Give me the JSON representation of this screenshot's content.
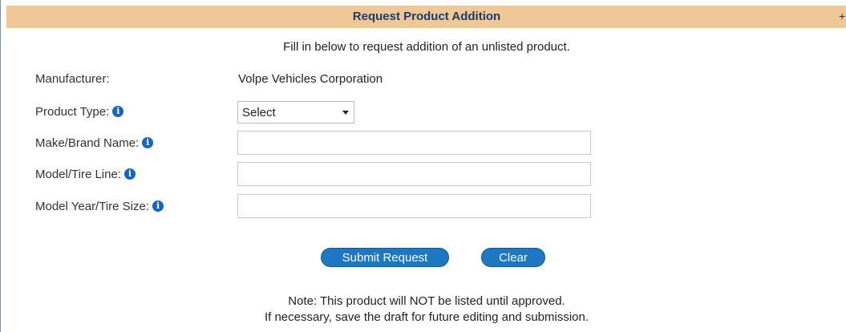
{
  "dialog": {
    "title": "Request Product Addition",
    "title_control": "+",
    "intro": "Fill in below to request addition of an unlisted product."
  },
  "form": {
    "manufacturer": {
      "label": "Manufacturer:",
      "value": "Volpe Vehicles Corporation"
    },
    "product_type": {
      "label": "Product Type:",
      "selected": "Select"
    },
    "make_brand": {
      "label": "Make/Brand Name:",
      "value": ""
    },
    "model_tire_line": {
      "label": "Model/Tire Line:",
      "value": ""
    },
    "model_year_tire_size": {
      "label": "Model Year/Tire Size:",
      "value": ""
    }
  },
  "actions": {
    "submit_label": "Submit Request",
    "clear_label": "Clear"
  },
  "notes": {
    "line1": "Note: This product will NOT be listed until approved.",
    "line2": "If necessary, save the draft for future editing and submission."
  },
  "icons": {
    "info": "info-circle-icon"
  },
  "colors": {
    "title_bar": "#f0c896",
    "title_text": "#1a3d6e",
    "button": "#1d78c1",
    "info_icon": "#1565c0"
  }
}
